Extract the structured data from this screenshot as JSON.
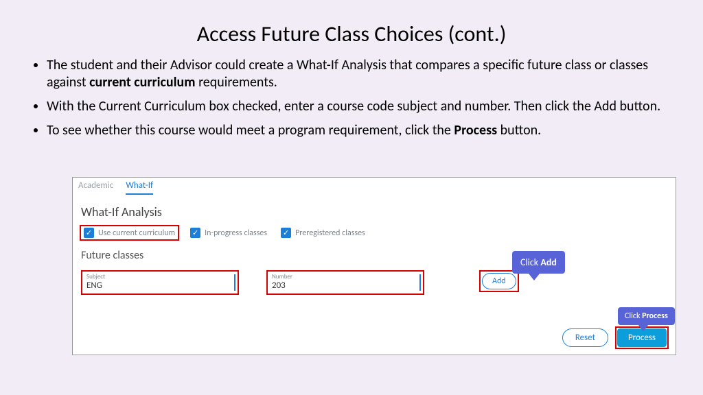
{
  "title": "Access Future Class Choices  (cont.)",
  "bullets": {
    "b1a": "The student and their Advisor could create a What-If Analysis that compares a specific future class or classes against ",
    "b1b": "current curriculum",
    "b1c": " requirements.",
    "b2": "With the Current Curriculum box checked, enter a course code subject and number. Then click the Add button.",
    "b3a": "To see whether this course would meet a program requirement, click the ",
    "b3b": "Process",
    "b3c": " button."
  },
  "panel": {
    "tabs": {
      "academic": "Academic",
      "whatif": "What-If"
    },
    "heading": "What-If Analysis",
    "checks": {
      "curr": "Use current curriculum",
      "inprog": "In-progress classes",
      "prereg": "Preregistered classes"
    },
    "future_heading": "Future classes",
    "subject": {
      "label": "Subject",
      "value": "ENG"
    },
    "number": {
      "label": "Number",
      "value": "203"
    },
    "add": "Add",
    "reset": "Reset",
    "process": "Process"
  },
  "callouts": {
    "add_pre": "Click ",
    "add_b": "Add",
    "process_pre": "Click ",
    "process_b": "Process"
  }
}
